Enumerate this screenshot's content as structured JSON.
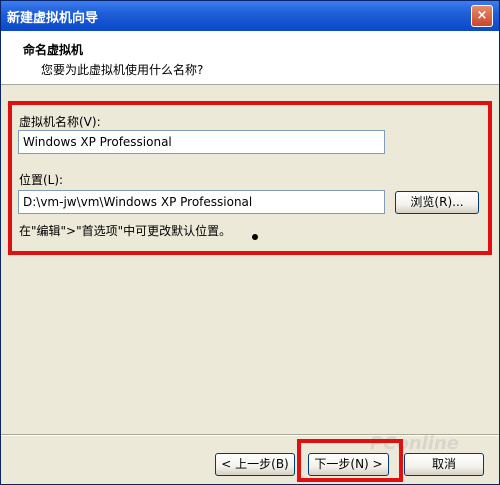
{
  "window": {
    "title": "新建虚拟机向导",
    "close_label": "×"
  },
  "header": {
    "title": "命名虚拟机",
    "subtitle": "您要为此虚拟机使用什么名称?"
  },
  "form": {
    "name_label": "虚拟机名称(V):",
    "name_value": "Windows XP Professional",
    "location_label": "位置(L):",
    "location_value": "D:\\vm-jw\\vm\\Windows XP Professional",
    "browse_label": "浏览(R)...",
    "hint": "在\"编辑\">\"首选项\"中可更改默认位置。"
  },
  "footer": {
    "back_label": "< 上一步(B)",
    "next_label": "下一步(N) >",
    "cancel_label": "取消"
  },
  "watermark": "PConline",
  "colors": {
    "highlight": "#e01010",
    "titlebar": "#1f5fd8"
  }
}
